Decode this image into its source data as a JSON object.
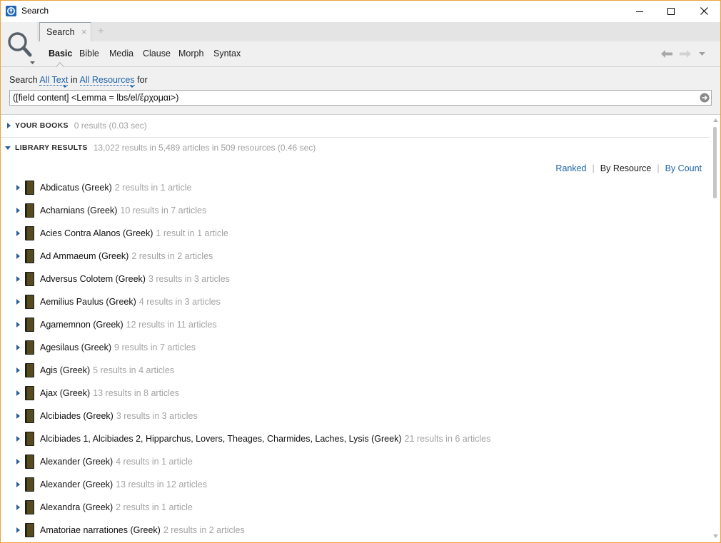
{
  "theme": {
    "link": "#1d63a9",
    "window_border": "#e9a53f",
    "expander": "#2c6196",
    "book": "#554a20"
  },
  "window": {
    "title": "Search",
    "app_icon": "logos-app-icon",
    "controls": {
      "minimize": "minimize-icon",
      "maximize": "maximize-icon",
      "close": "close-icon"
    }
  },
  "panel_menu_icon": "search-magnifier-icon",
  "tabs": [
    {
      "label": "Search",
      "close_glyph": "×",
      "active": true
    }
  ],
  "new_tab_glyph": "+",
  "search_types": [
    {
      "label": "Basic",
      "selected": true
    },
    {
      "label": "Bible",
      "selected": false
    },
    {
      "label": "Media",
      "selected": false
    },
    {
      "label": "Clause",
      "selected": false
    },
    {
      "label": "Morph",
      "selected": false
    },
    {
      "label": "Syntax",
      "selected": false
    }
  ],
  "history_nav": {
    "back_icon": "back-arrow-icon",
    "forward_icon": "forward-arrow-icon",
    "menu_icon": "history-dropdown-icon"
  },
  "query_bar": {
    "prefix": "Search",
    "text_scope": "All Text",
    "joiner": "in",
    "resource_scope": "All Resources",
    "suffix": "for",
    "query": "([field content] <Lemma = lbs/el/ἔρχομαι>)",
    "go_icon": "go-arrow-icon"
  },
  "sections": {
    "your_books": {
      "label": "YOUR BOOKS",
      "summary": "0 results (0.03 sec)",
      "expanded": false
    },
    "library_results": {
      "label": "LIBRARY RESULTS",
      "summary": "13,022 results in 5,489 articles in 509 resources (0.46 sec)",
      "expanded": true
    }
  },
  "sort": {
    "separator": "|",
    "options": [
      {
        "label": "Ranked",
        "selected": false
      },
      {
        "label": "By Resource",
        "selected": true
      },
      {
        "label": "By Count",
        "selected": false
      }
    ]
  },
  "results": [
    {
      "title": "Abdicatus (Greek)",
      "count": "2 results in 1 article"
    },
    {
      "title": "Acharnians (Greek)",
      "count": "10 results in 7 articles"
    },
    {
      "title": "Acies Contra Alanos (Greek)",
      "count": "1 result in 1 article"
    },
    {
      "title": "Ad Ammaeum (Greek)",
      "count": "2 results in 2 articles"
    },
    {
      "title": "Adversus Colotem (Greek)",
      "count": "3 results in 3 articles"
    },
    {
      "title": "Aemilius Paulus (Greek)",
      "count": "4 results in 3 articles"
    },
    {
      "title": "Agamemnon (Greek)",
      "count": "12 results in 11 articles"
    },
    {
      "title": "Agesilaus (Greek)",
      "count": "9 results in 7 articles"
    },
    {
      "title": "Agis (Greek)",
      "count": "5 results in 4 articles"
    },
    {
      "title": "Ajax (Greek)",
      "count": "13 results in 8 articles"
    },
    {
      "title": "Alcibiades (Greek)",
      "count": "3 results in 3 articles"
    },
    {
      "title": "Alcibiades 1, Alcibiades 2, Hipparchus, Lovers, Theages, Charmides, Laches, Lysis (Greek)",
      "count": "21 results in 6 articles"
    },
    {
      "title": "Alexander (Greek)",
      "count": "4 results in 1 article"
    },
    {
      "title": "Alexander (Greek)",
      "count": "13 results in 12 articles"
    },
    {
      "title": "Alexandra (Greek)",
      "count": "2 results in 1 article"
    },
    {
      "title": "Amatoriae narrationes (Greek)",
      "count": "2 results in 2 articles"
    }
  ]
}
